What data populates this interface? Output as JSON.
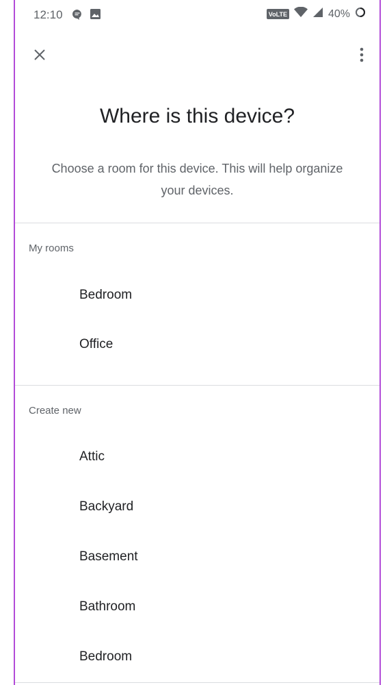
{
  "status_bar": {
    "time": "12:10",
    "network_badge": "VoLTE",
    "battery": "40%"
  },
  "page": {
    "title": "Where is this device?",
    "subtitle": "Choose a room for this device. This will help organize your devices."
  },
  "my_rooms": {
    "header": "My rooms",
    "items": [
      "Bedroom",
      "Office"
    ]
  },
  "create_new": {
    "header": "Create new",
    "items": [
      "Attic",
      "Backyard",
      "Basement",
      "Bathroom",
      "Bedroom"
    ]
  },
  "icons": {
    "close": "close-icon",
    "menu": "more-vert-icon"
  },
  "colors": {
    "frame_border": "#b24bd8",
    "text_primary": "#202124",
    "text_secondary": "#5f6368",
    "divider": "#dadce0"
  }
}
